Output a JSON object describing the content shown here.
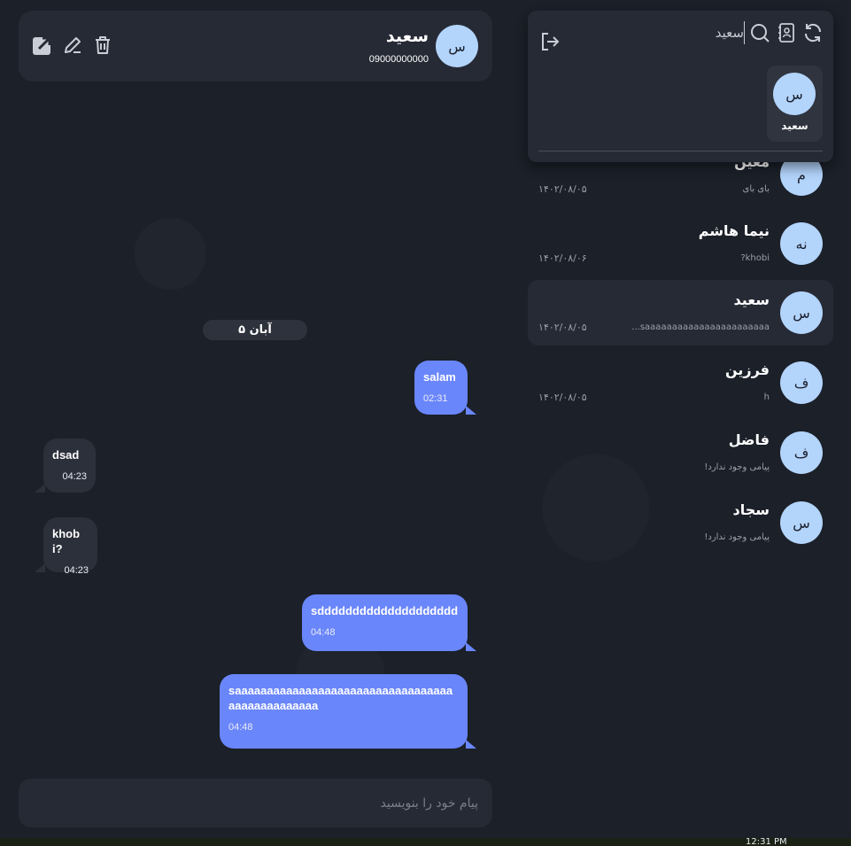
{
  "header": {
    "avatar_letter": "س",
    "name": "سعید",
    "phone": "09000000000"
  },
  "date_separator": "۵ آبان",
  "messages": [
    {
      "dir": "out",
      "text": "salam",
      "time": "02:31"
    },
    {
      "dir": "in",
      "text": "dsad",
      "time": "04:23"
    },
    {
      "dir": "in",
      "text": "khobi?",
      "time": "04:23"
    },
    {
      "dir": "out",
      "text": "sdddddddddddddddddddd",
      "time": "04:48"
    },
    {
      "dir": "out",
      "text": "saaaaaaaaaaaaaaaaaaaaaaaaaaaaaaaaaaaaaaaaaaaaaaaa",
      "time": "04:48"
    }
  ],
  "composer": {
    "placeholder": "پیام خود را بنویسید"
  },
  "search": {
    "value": "سعید",
    "result": {
      "avatar_letter": "س",
      "name": "سعید"
    }
  },
  "conversations": [
    {
      "avatar_letter": "م",
      "name": "معین",
      "preview": "بای بای",
      "date": "۱۴۰۲/۰۸/۰۵",
      "active": false
    },
    {
      "avatar_letter": "نه",
      "name": "نیما هاشم",
      "preview": "khobi?",
      "date": "۱۴۰۲/۰۸/۰۶",
      "active": false
    },
    {
      "avatar_letter": "س",
      "name": "سعید",
      "preview": "saaaaaaaaaaaaaaaaaaaaaaa...",
      "date": "۱۴۰۲/۰۸/۰۵",
      "active": true
    },
    {
      "avatar_letter": "ف",
      "name": "فرزین",
      "preview": "h",
      "date": "۱۴۰۲/۰۸/۰۵",
      "active": false
    },
    {
      "avatar_letter": "ف",
      "name": "فاضل",
      "preview": "پیامی وجود ندارد!",
      "date": "",
      "active": false
    },
    {
      "avatar_letter": "س",
      "name": "سجاد",
      "preview": "پیامی وجود ندارد!",
      "date": "",
      "active": false
    }
  ],
  "icons": {
    "header": [
      "open-external-icon",
      "edit-icon",
      "trash-icon"
    ],
    "search_toolbar": [
      "refresh-icon",
      "contacts-icon",
      "search-icon"
    ],
    "logout": "logout-icon"
  },
  "colors": {
    "background": "#1b2029",
    "panel": "#262a35",
    "outgoing_bubble": "#6a86fb",
    "incoming_bubble": "#2c303a",
    "avatar": "#b3d4fb"
  },
  "taskbar": {
    "clock": "12:31 PM"
  }
}
